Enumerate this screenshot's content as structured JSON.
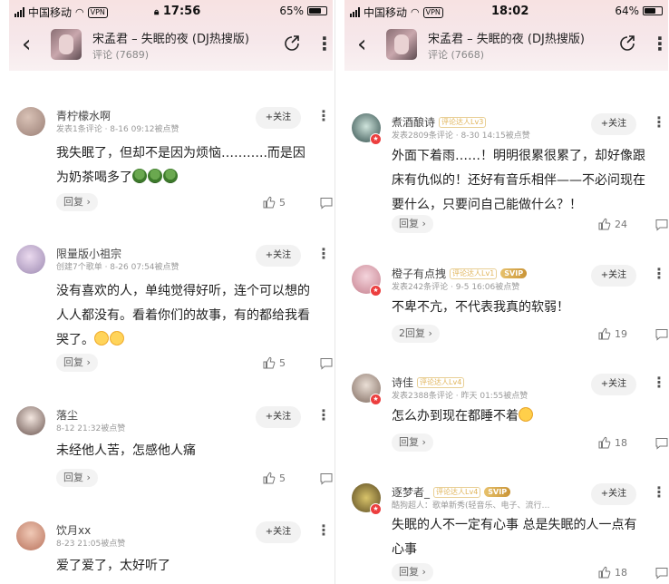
{
  "status_left": {
    "carrier": "中国移动",
    "vpn": "VPN",
    "time": "17:56",
    "battery": "65%"
  },
  "status_right": {
    "carrier": "中国移动",
    "vpn": "VPN",
    "time": "18:02",
    "battery": "64%"
  },
  "header_left": {
    "song_title": "宋孟君 – 失眠的夜 (DJ热搜版)",
    "subtitle": "评论 (7689)"
  },
  "header_right": {
    "song_title": "宋孟君 – 失眠的夜 (DJ热搜版)",
    "subtitle": "评论 (7668)"
  },
  "colors": {
    "header_bg": "#f7e2e2",
    "accent_red": "#ec3e3e",
    "level_gold": "#e0b45a"
  },
  "icons": {
    "back": "chevron-left-icon",
    "share": "share-icon",
    "more": "more-vertical-icon",
    "like": "thumbs-up-icon",
    "comment": "comment-icon"
  },
  "left_comments": [
    {
      "user": "青柠檬水啊",
      "meta": "发表1条评论 · 8-16 09:12被点赞",
      "follow": "+关注",
      "text": "我失眠了，但却不是因为烦恼………..而是因为奶茶喝多了",
      "reply": "回复 ›",
      "likes": "5"
    },
    {
      "user": "限量版小祖宗",
      "meta": "创建7个歌单 · 8-26 07:54被点赞",
      "follow": "+关注",
      "text": "没有喜欢的人，单纯觉得好听，连个可以想的人人都没有。看着你们的故事，有的都给我看哭了。",
      "reply": "回复 ›",
      "likes": "5"
    },
    {
      "user": "落尘",
      "meta": "8-12 21:32被点赞",
      "follow": "+关注",
      "text": "未经他人苦，怎感他人痛",
      "reply": "回复 ›",
      "likes": "5"
    },
    {
      "user": "饮月xx",
      "meta": "8-23 21:05被点赞",
      "follow": "+关注",
      "text": "爱了爱了，太好听了",
      "reply": "",
      "likes": ""
    }
  ],
  "right_comments": [
    {
      "user": "煮酒酿诗",
      "level": "评论达人Lv3",
      "vip": "",
      "meta": "发表2809条评论 · 8-30 14:15被点赞",
      "follow": "+关注",
      "text": "外面下着雨……！明明很累很累了，却好像跟床有仇似的！还好有音乐相伴——不必问现在要什么，只要问自己能做什么？！",
      "reply": "回复 ›",
      "likes": "24"
    },
    {
      "user": "橙子有点拽",
      "level": "评论达人Lv1",
      "vip": "SVIP",
      "meta": "发表242条评论 · 9-5 16:06被点赞",
      "follow": "+关注",
      "text": "不卑不亢，不代表我真的软弱！",
      "reply": "2回复 ›",
      "likes": "19"
    },
    {
      "user": "诗佳",
      "level": "评论达人Lv4",
      "vip": "",
      "meta": "发表2388条评论 · 昨天 01:55被点赞",
      "follow": "+关注",
      "text": "怎么办到现在都睡不着",
      "reply": "回复 ›",
      "likes": "18"
    },
    {
      "user": "逐梦者_",
      "level": "评论达人Lv4",
      "vip": "SVIP",
      "meta": "酷狗超人：歌单新秀(轻音乐、电子、流行…",
      "follow": "+关注",
      "text": "失眠的人不一定有心事 总是失眠的人一点有心事",
      "reply": "回复 ›",
      "likes": "18"
    }
  ]
}
